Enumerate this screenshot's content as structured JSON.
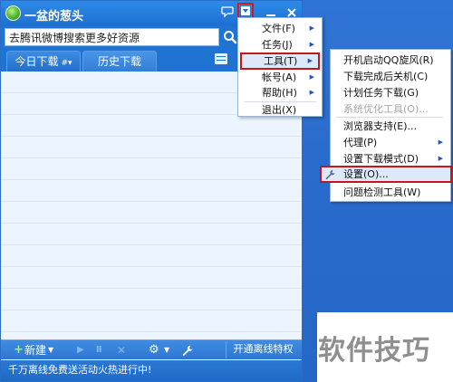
{
  "window": {
    "title": "一盆的葱头",
    "search_value": "去腾讯微博搜索更多好资源",
    "tabs": {
      "today": "今日下载",
      "today_caret": "#▾",
      "history": "历史下载"
    },
    "toolbar": {
      "new_icon": "+",
      "new_label": "新建",
      "offline": "开通离线特权"
    },
    "status": "千万离线免费送活动火热进行中!"
  },
  "main_menu": {
    "items": [
      {
        "label": "文件(F)",
        "has_submenu": true
      },
      {
        "label": "任务(J)",
        "has_submenu": true
      },
      {
        "label": "工具(T)",
        "has_submenu": true,
        "highlighted": true
      },
      {
        "label": "帐号(A)",
        "has_submenu": true
      },
      {
        "label": "帮助(H)",
        "has_submenu": true
      },
      {
        "label": "退出(X)",
        "has_submenu": false
      }
    ]
  },
  "tools_menu": {
    "items": [
      {
        "label": "开机启动QQ旋风(R)"
      },
      {
        "label": "下载完成后关机(C)"
      },
      {
        "label": "计划任务下载(G)"
      },
      {
        "label": "系统优化工具(O)...",
        "disabled": true
      },
      {
        "label": "浏览器支持(E)..."
      },
      {
        "label": "代理(P)",
        "has_submenu": true
      },
      {
        "label": "设置下载模式(D)",
        "has_submenu": true
      },
      {
        "label": "设置(O)...",
        "highlighted": true,
        "icon": "wrench-icon"
      },
      {
        "label": "问题检测工具(W)"
      }
    ]
  },
  "watermark": "软件技巧",
  "colors": {
    "titlebar": "#1d6fd0",
    "desktop": "#2a6ccd",
    "highlight_border": "#c3171b",
    "list_bg": "#ecf5ff"
  },
  "icons": {
    "app_logo": "qq-whirlwind-logo",
    "skin": "chat-bubble-icon",
    "menu": "menu-dropdown-icon",
    "minimize": "minimize-icon",
    "close": "close-icon",
    "search": "search-icon",
    "list_view": "list-view-icon",
    "play": "play-icon",
    "pause": "pause-icon",
    "delete": "delete-icon",
    "settings": "gear-icon",
    "tool": "wrench-icon"
  }
}
